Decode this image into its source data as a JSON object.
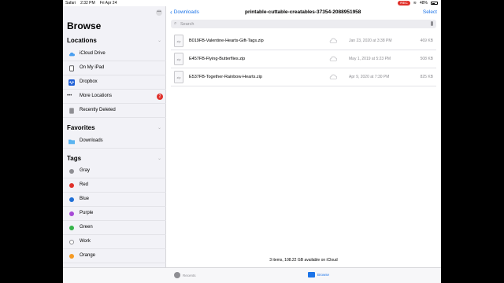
{
  "status_bar": {
    "app": "Safari",
    "time": "2:32 PM",
    "date": "Fri Apr 24",
    "recording": "REC",
    "battery": "48%"
  },
  "sidebar": {
    "title": "Browse",
    "locations_header": "Locations",
    "locations": [
      {
        "label": "iCloud Drive",
        "icon": "icloud-icon",
        "color": "#4a9ff0"
      },
      {
        "label": "On My iPad",
        "icon": "ipad-icon",
        "color": "#3a3a3c"
      },
      {
        "label": "Dropbox",
        "icon": "dropbox-icon",
        "color": "#1f5fd6"
      },
      {
        "label": "More Locations",
        "icon": "ellipsis-icon",
        "badge": "2"
      },
      {
        "label": "Recently Deleted",
        "icon": "trash-icon",
        "color": "#8e8e93"
      }
    ],
    "favorites_header": "Favorites",
    "favorites": [
      {
        "label": "Downloads",
        "icon": "folder-icon",
        "color": "#5bb4f0"
      }
    ],
    "tags_header": "Tags",
    "tags": [
      {
        "label": "Gray",
        "color": "#8e8e93"
      },
      {
        "label": "Red",
        "color": "#e0302a"
      },
      {
        "label": "Blue",
        "color": "#1f6fd6"
      },
      {
        "label": "Purple",
        "color": "#a74bd6"
      },
      {
        "label": "Green",
        "color": "#35b34a"
      },
      {
        "label": "Work",
        "color": "#ffffff"
      },
      {
        "label": "Orange",
        "color": "#f59a23"
      }
    ]
  },
  "nav": {
    "back_label": "Downloads",
    "title": "printable-cuttable-creatables-37354-2088951958",
    "select_label": "Select"
  },
  "search": {
    "placeholder": "Search"
  },
  "files": [
    {
      "name": "B019FB-Valentine-Hearts-Gift-Tags.zip",
      "type_label": "zip",
      "date": "Jan 23, 2020 at 3:38 PM",
      "size": "469 KB"
    },
    {
      "name": "E457FB-Flying-Butterflies.zip",
      "type_label": "zip",
      "date": "May 1, 2019 at 5:23 PM",
      "size": "508 KB"
    },
    {
      "name": "E537FB-Together-Rainbow-Hearts.zip",
      "type_label": "zip",
      "date": "Apr 9, 2020 at 7:30 PM",
      "size": "825 KB"
    }
  ],
  "footer": {
    "info": "3 items, 108.22 GB available on iCloud"
  },
  "tabbar": {
    "recents_label": "Recents",
    "browse_label": "Browse",
    "active_color": "#1c74e8"
  }
}
